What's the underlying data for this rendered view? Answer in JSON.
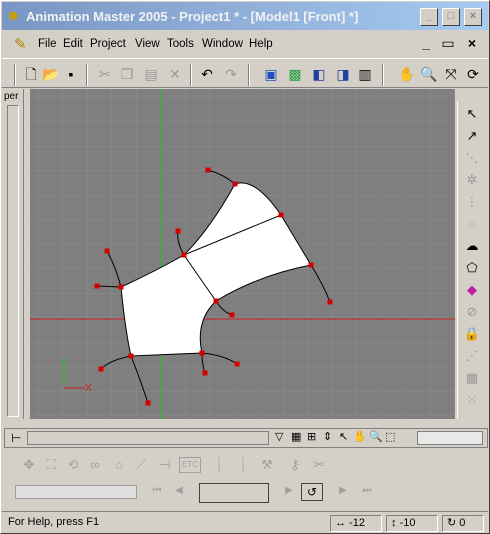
{
  "window": {
    "title": "Animation Master 2005 - Project1 * - [Model1 [Front] *]",
    "controls": [
      "_",
      "□",
      "×"
    ]
  },
  "menu": {
    "items": [
      "File",
      "Edit",
      "Project",
      "View",
      "Tools",
      "Window",
      "Help"
    ],
    "mdi_controls": [
      "_",
      "▭",
      "×"
    ]
  },
  "toolbar": {
    "icons": [
      "new-icon",
      "open-icon",
      "save-icon",
      "cut-icon",
      "copy-icon",
      "paste-icon",
      "delete-icon",
      "undo-icon",
      "redo-icon",
      "render-icon",
      "render-region-icon",
      "render-to-file-icon",
      "shaded-icon",
      "wireframe-icon",
      "hand-pan-icon",
      "zoom-icon",
      "zoom-fit-icon",
      "rotate-icon"
    ]
  },
  "left_panel": {
    "tab_label": "per"
  },
  "viewport": {
    "axis_y_label": "Y",
    "axis_x_label": "X",
    "colors": {
      "background": "#7f7f7f",
      "grid": "#8d8d8d",
      "x_axis": "#c82020",
      "y_axis": "#1fbf1f",
      "patch": "#ffffff",
      "spline": "#000000",
      "cp": "#d40000"
    }
  },
  "right_toolbar": {
    "icons": [
      "select-arrow-icon",
      "add-mode-icon",
      "lathe-icon",
      "extrude-icon",
      "dotted-spline-icon",
      "dotted-circle-icon",
      "lasso-icon",
      "shape-icon",
      "bone-icon",
      "circle-tool-icon",
      "lock-icon",
      "group-icon",
      "grid-icon",
      "dots-icon"
    ]
  },
  "anim_panel": {
    "etc_label": "ETC"
  },
  "status": {
    "help_text": "For Help, press F1",
    "x_coord": "-12",
    "y_coord": "-10",
    "angle": "0"
  }
}
